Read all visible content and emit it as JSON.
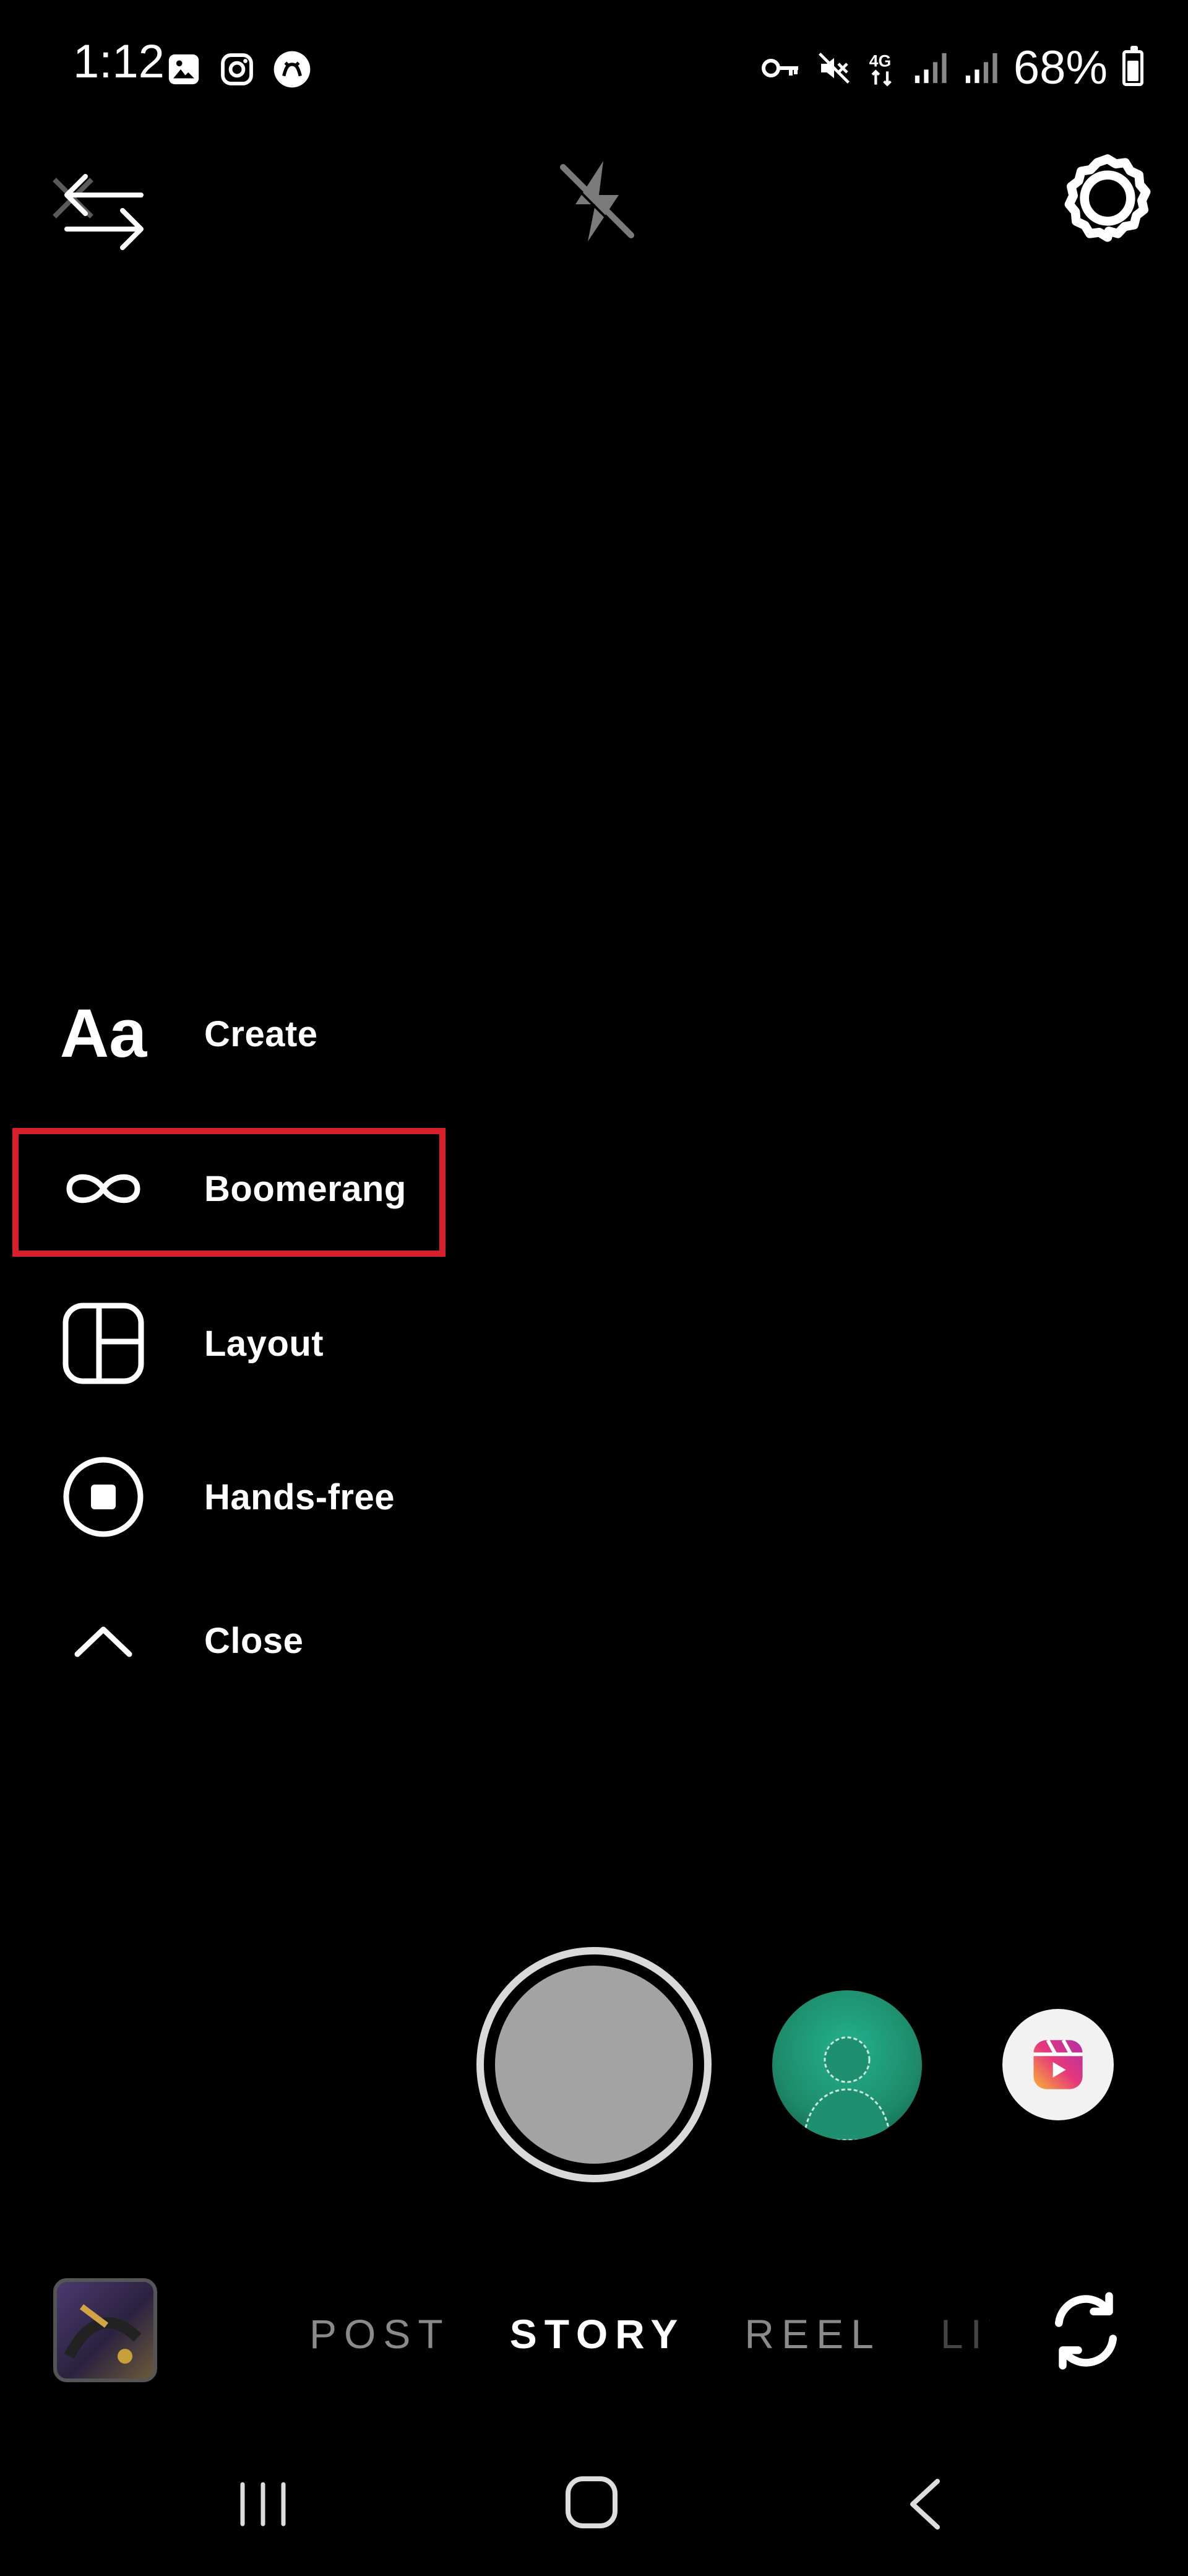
{
  "status_bar": {
    "time": "1:12",
    "battery": "68%",
    "icons_left": [
      "gallery-icon",
      "instagram-icon",
      "app-icon"
    ],
    "icons_right": [
      "vpn-key-icon",
      "mute-icon",
      "network-4g-icon",
      "signal-icon",
      "signal-icon"
    ]
  },
  "top_controls": {
    "close_icon": "close-switch-icon",
    "flash_icon": "flash-off-icon",
    "settings_icon": "settings-gear-icon"
  },
  "side_menu": {
    "items": [
      {
        "label": "Create",
        "icon": "text-aa-icon"
      },
      {
        "label": "Boomerang",
        "icon": "infinity-icon"
      },
      {
        "label": "Layout",
        "icon": "layout-grid-icon"
      },
      {
        "label": "Hands-free",
        "icon": "hands-free-icon"
      },
      {
        "label": "Close",
        "icon": "chevron-up-icon"
      }
    ],
    "highlighted": "Boomerang"
  },
  "text_glyph": "Aa",
  "modes": {
    "tabs": [
      "POST",
      "STORY",
      "REEL",
      "LIVE"
    ],
    "active": "STORY"
  },
  "colors": {
    "background": "#000000",
    "highlight_border": "#d7202b",
    "shutter_fill": "#a3a3a3",
    "avatar_green": "#23b38e"
  }
}
